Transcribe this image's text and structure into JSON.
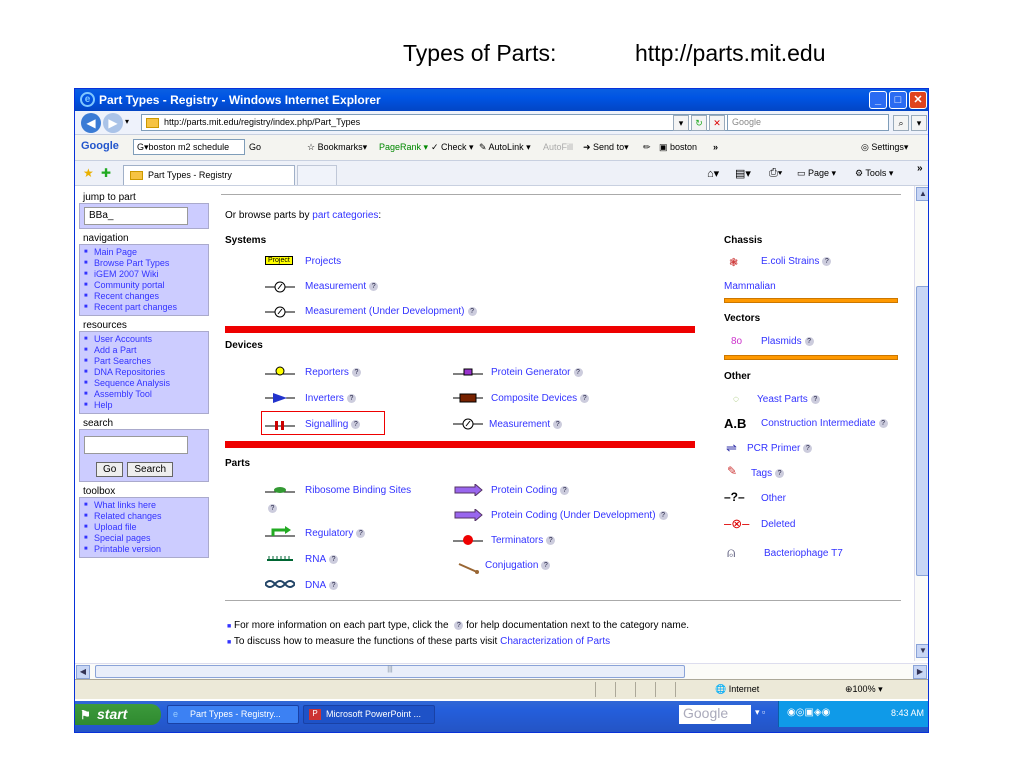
{
  "slide": {
    "title_left": "Types of Parts:",
    "title_right": "http://parts.mit.edu"
  },
  "window": {
    "title": "Part Types - Registry - Windows Internet Explorer",
    "url": "http://parts.mit.edu/registry/index.php/Part_Types",
    "search_placeholder": "Google",
    "google_toolbar": {
      "query": "boston m2 schedule",
      "go": "Go",
      "bookmarks": "Bookmarks▾",
      "pagerank": "PageRank ▾",
      "check": "Check ▾",
      "autolink": "AutoLink ▾",
      "autofill": "AutoFill",
      "sendto": "Send to▾",
      "boston": "boston",
      "more": "»",
      "settings": "Settings▾"
    },
    "tab_label": "Part Types - Registry",
    "cmd": {
      "page": "Page ▾",
      "tools": "Tools ▾"
    },
    "status": {
      "zone": "Internet",
      "zoom": "100%"
    }
  },
  "sidebar": {
    "jump_label": "jump to part",
    "jump_value": "BBa_",
    "navigation_label": "navigation",
    "navigation": [
      "Main Page",
      "Browse Part Types",
      "iGEM 2007 Wiki",
      "Community portal",
      "Recent changes",
      "Recent part changes"
    ],
    "resources_label": "resources",
    "resources": [
      "User Accounts",
      "Add a Part",
      "Part Searches",
      "DNA Repositories",
      "Sequence Analysis",
      "Assembly Tool",
      "Help"
    ],
    "search_label": "search",
    "go_btn": "Go",
    "search_btn": "Search",
    "toolbox_label": "toolbox",
    "toolbox": [
      "What links here",
      "Related changes",
      "Upload file",
      "Special pages",
      "Printable version"
    ]
  },
  "main": {
    "browse_prefix": "Or browse parts by",
    "browse_link": "part categories",
    "browse_suffix": ":",
    "systems": "Systems",
    "projects": "Projects",
    "measurement": "Measurement",
    "measurement_dev": "Measurement (Under Development)",
    "devices": "Devices",
    "reporters": "Reporters",
    "inverters": "Inverters",
    "signalling": "Signalling",
    "protein_generator": "Protein Generator",
    "composite_devices": "Composite Devices",
    "measurement2": "Measurement",
    "parts": "Parts",
    "rbs": "Ribosome Binding Sites",
    "regulatory": "Regulatory",
    "rna": "RNA",
    "dna": "DNA",
    "protein_coding": "Protein Coding",
    "protein_coding_dev": "Protein Coding (Under Development)",
    "terminators": "Terminators",
    "conjugation": "Conjugation",
    "chassis": "Chassis",
    "ecoli": "E.coli Strains",
    "mammalian": "Mammalian",
    "vectors": "Vectors",
    "plasmids": "Plasmids",
    "other_h": "Other",
    "yeast": "Yeast Parts",
    "construction": "Construction Intermediate",
    "pcr": "PCR Primer",
    "tags": "Tags",
    "other": "Other",
    "deleted": "Deleted",
    "phage": "Bacteriophage T7",
    "note1_a": "For more information on each part type, click the",
    "note1_b": "for help documentation next to the category name.",
    "note2_a": "To discuss how to measure the functions of these parts visit",
    "note2_link": "Characterization of Parts",
    "project_badge": "Project",
    "ab_glyph": "A.B"
  },
  "taskbar": {
    "start": "start",
    "task1": "Part Types - Registry...",
    "task2": "Microsoft PowerPoint ...",
    "google": "Google",
    "time": "8:43 AM"
  },
  "colors": {
    "link": "#3333ff",
    "sidebar_bg": "#ccccff",
    "red_bar": "#ee0000",
    "orange_bar": "#ff9900"
  }
}
